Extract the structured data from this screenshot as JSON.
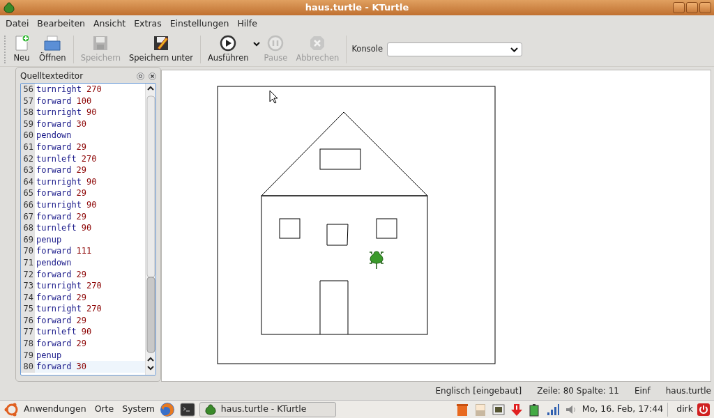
{
  "window": {
    "title": "haus.turtle - KTurtle"
  },
  "menu": [
    "Datei",
    "Bearbeiten",
    "Ansicht",
    "Extras",
    "Einstellungen",
    "Hilfe"
  ],
  "toolbar": [
    {
      "kind": "new",
      "label": "Neu",
      "disabled": false
    },
    {
      "kind": "open",
      "label": "Öffnen",
      "disabled": false
    },
    {
      "kind": "save",
      "label": "Speichern",
      "disabled": true
    },
    {
      "kind": "saveas",
      "label": "Speichern unter",
      "disabled": false
    },
    {
      "kind": "run",
      "label": "Ausführen",
      "disabled": false
    },
    {
      "kind": "pause",
      "label": "Pause",
      "disabled": true
    },
    {
      "kind": "abort",
      "label": "Abbrechen",
      "disabled": true
    }
  ],
  "console": {
    "label": "Konsole"
  },
  "editor": {
    "title": "Quelltexteditor",
    "lines": [
      {
        "number": "56",
        "command": "turnright",
        "argument": "270",
        "current": false
      },
      {
        "number": "57",
        "command": "forward",
        "argument": "100",
        "current": false
      },
      {
        "number": "58",
        "command": "turnright",
        "argument": "90",
        "current": false
      },
      {
        "number": "59",
        "command": "forward",
        "argument": "30",
        "current": false
      },
      {
        "number": "60",
        "command": "pendown",
        "current": false
      },
      {
        "number": "61",
        "command": "forward",
        "argument": "29",
        "current": false
      },
      {
        "number": "62",
        "command": "turnleft",
        "argument": "270",
        "current": false
      },
      {
        "number": "63",
        "command": "forward",
        "argument": "29",
        "current": false
      },
      {
        "number": "64",
        "command": "turnright",
        "argument": "90",
        "current": false
      },
      {
        "number": "65",
        "command": "forward",
        "argument": "29",
        "current": false
      },
      {
        "number": "66",
        "command": "turnright",
        "argument": "90",
        "current": false
      },
      {
        "number": "67",
        "command": "forward",
        "argument": "29",
        "current": false
      },
      {
        "number": "68",
        "command": "turnleft",
        "argument": "90",
        "current": false
      },
      {
        "number": "69",
        "command": "penup",
        "current": false
      },
      {
        "number": "70",
        "command": "forward",
        "argument": "111",
        "current": false
      },
      {
        "number": "71",
        "command": "pendown",
        "current": false
      },
      {
        "number": "72",
        "command": "forward",
        "argument": "29",
        "current": false
      },
      {
        "number": "73",
        "command": "turnright",
        "argument": "270",
        "current": false
      },
      {
        "number": "74",
        "command": "forward",
        "argument": "29",
        "current": false
      },
      {
        "number": "75",
        "command": "turnright",
        "argument": "270",
        "current": false
      },
      {
        "number": "76",
        "command": "forward",
        "argument": "29",
        "current": false
      },
      {
        "number": "77",
        "command": "turnleft",
        "argument": "90",
        "current": false
      },
      {
        "number": "78",
        "command": "forward",
        "argument": "29",
        "current": false
      },
      {
        "number": "79",
        "command": "penup",
        "current": false
      },
      {
        "number": "80",
        "command": "forward",
        "argument": "30",
        "current": true
      }
    ]
  },
  "status_bar": [
    "Englisch [eingebaut]",
    "Zeile: 80 Spalte: 11",
    "Einf",
    "haus.turtle"
  ],
  "taskbar": {
    "menus": [
      "Anwendungen",
      "Orte",
      "System"
    ],
    "windows": [
      {
        "label": "haus.turtle - KTurtle",
        "selected": false
      }
    ],
    "clock": "Mo, 16. Feb, 17:44",
    "user": "dirk"
  }
}
